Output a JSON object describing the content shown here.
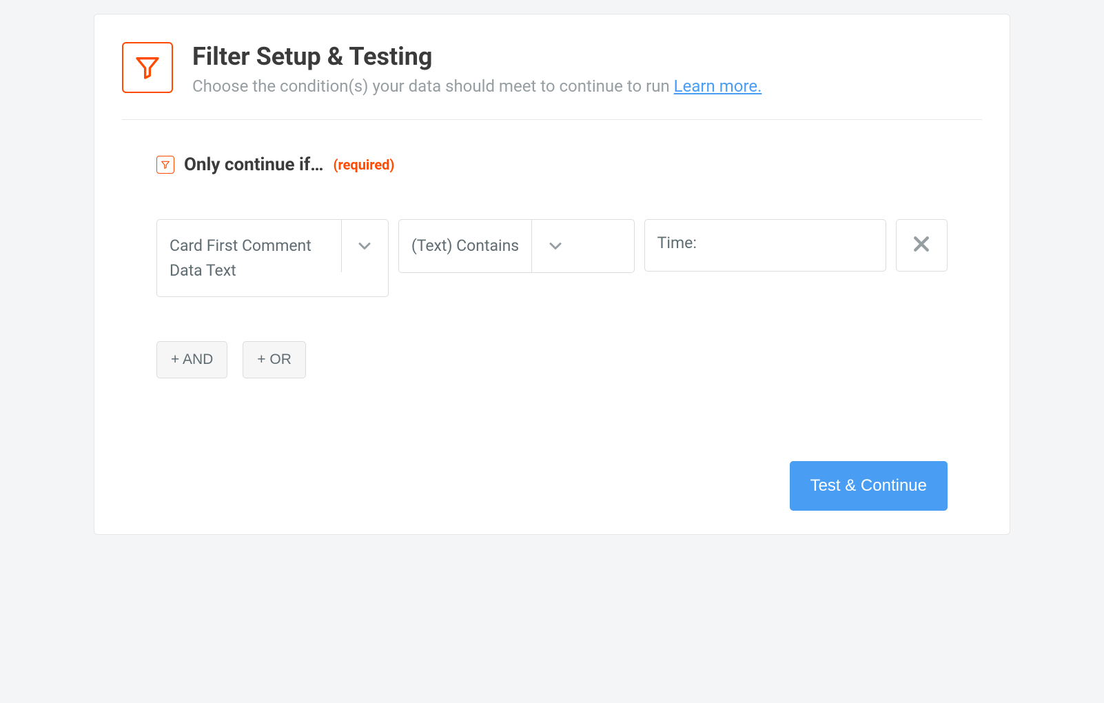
{
  "header": {
    "title": "Filter Setup & Testing",
    "subtitle": "Choose the condition(s) your data should meet to continue to run ",
    "learn_more": "Learn more."
  },
  "condition": {
    "label": "Only continue if…",
    "required": "(required)"
  },
  "row": {
    "field": "Card First Comment Data Text",
    "operator": "(Text) Contains",
    "value": "Time:"
  },
  "logic": {
    "and": "+ AND",
    "or": "+ OR"
  },
  "footer": {
    "test_continue": "Test & Continue"
  }
}
